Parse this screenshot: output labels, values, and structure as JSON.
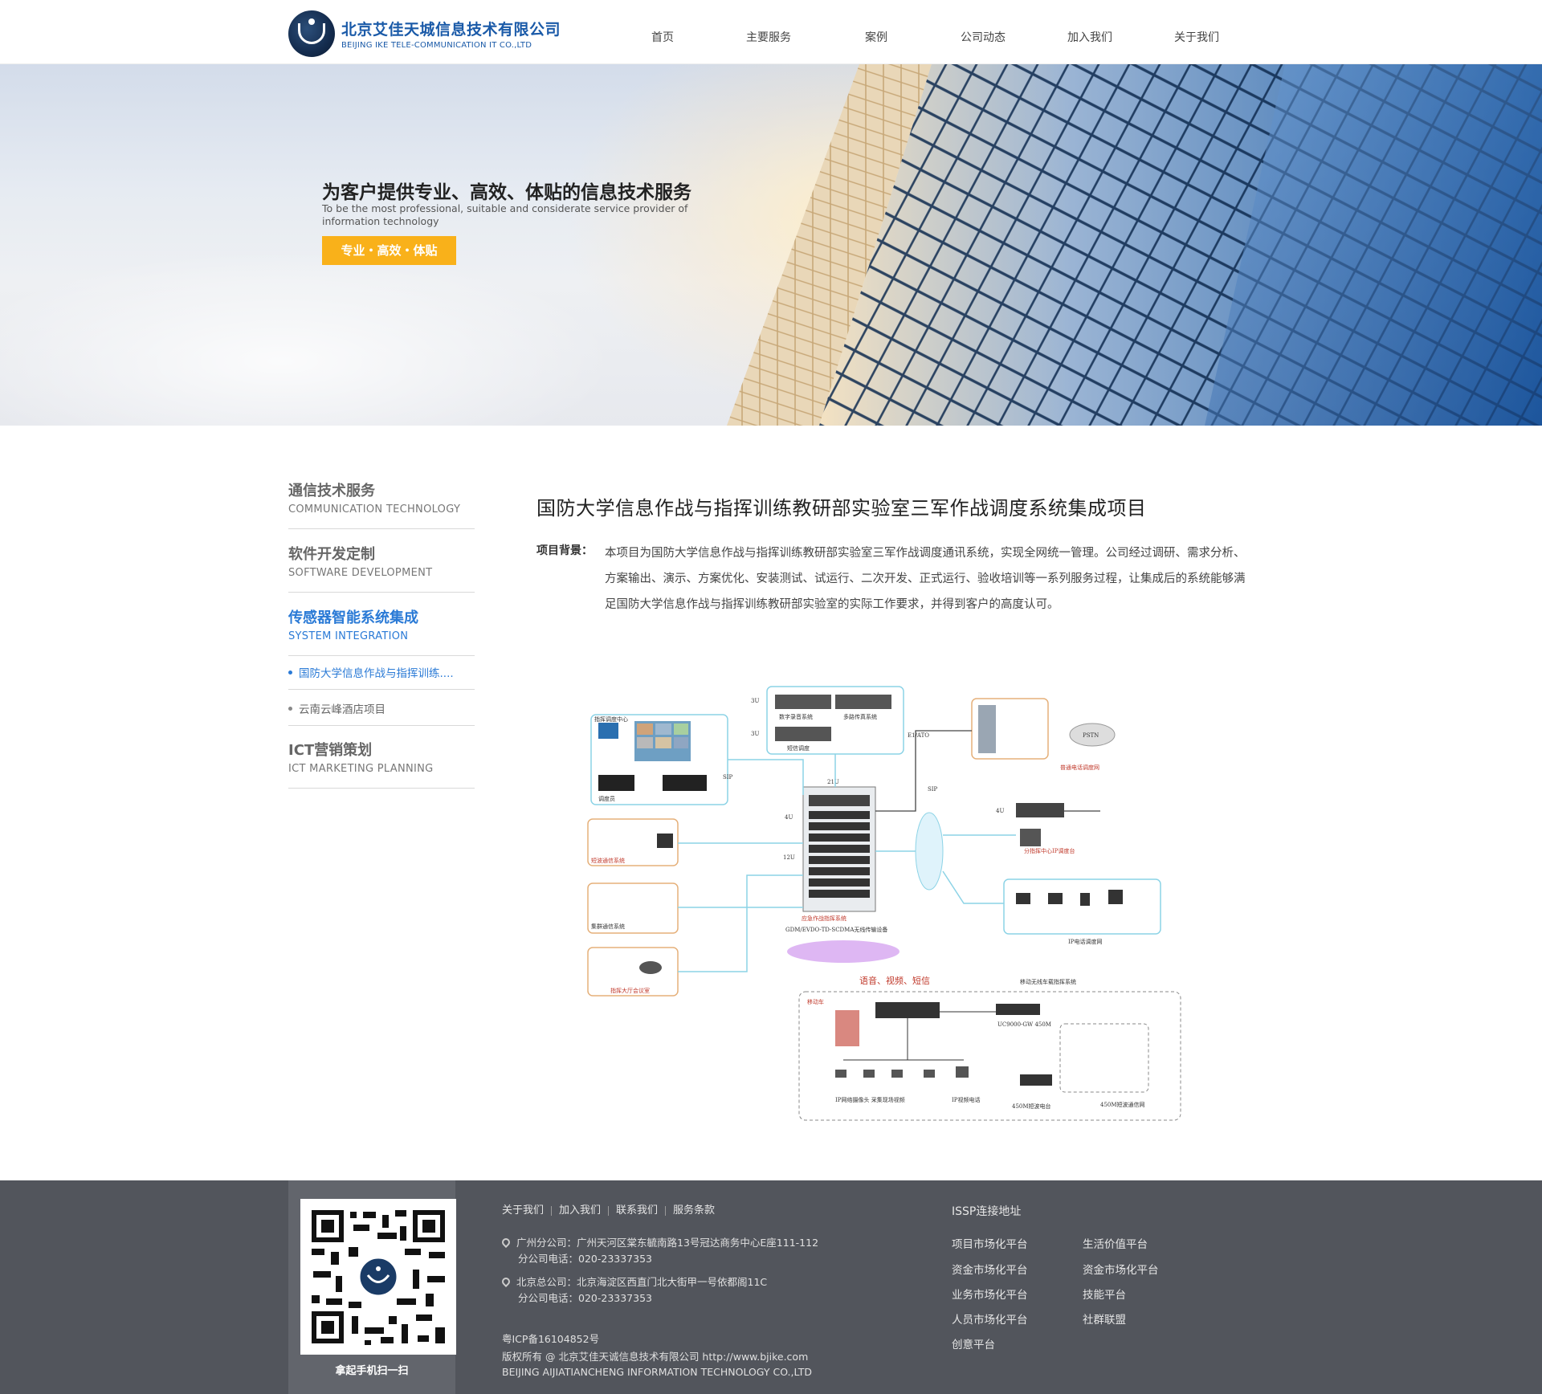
{
  "header": {
    "logo_cn": "北京艾佳天城信息技术有限公司",
    "logo_en": "BEIJING IKE TELE-COMMUNICATION IT CO.,LTD",
    "nav": [
      "首页",
      "主要服务",
      "案例",
      "公司动态",
      "加入我们",
      "关于我们"
    ]
  },
  "banner": {
    "title": "为客户提供专业、高效、体贴的信息技术服务",
    "subtitle": "To be the most professional, suitable and considerate service provider of information technology",
    "button": "专业・高效・体贴"
  },
  "sidebar": {
    "categories": [
      {
        "cn": "通信技术服务",
        "en": "COMMUNICATION TECHNOLOGY"
      },
      {
        "cn": "软件开发定制",
        "en": "SOFTWARE DEVELOPMENT"
      },
      {
        "cn": "传感器智能系统集成",
        "en": "SYSTEM INTEGRATION"
      },
      {
        "cn": "ICT营销策划",
        "en": "ICT MARKETING PLANNING"
      }
    ],
    "sub_items": [
      "国防大学信息作战与指挥训练....",
      "云南云峰酒店项目"
    ]
  },
  "main": {
    "title": "国防大学信息作战与指挥训练教研部实验室三军作战调度系统集成项目",
    "background_label": "项目背景：",
    "background_text": "本项目为国防大学信息作战与指挥训练教研部实验室三军作战调度通讯系统，实现全网统一管理。公司经过调研、需求分析、方案输出、演示、方案优化、安装测试、试运行、二次开发、正式运行、验收培训等一系列服务过程，让集成后的系统能够满足国防大学信息作战与指挥训练教研部实验室的实际工作要求，并得到客户的高度认可。"
  },
  "diagram": {
    "labels": [
      "数字录音系统",
      "多路传真系统",
      "短信调度",
      "指挥调度中心",
      "调度员",
      "SIP",
      "E1/ATO",
      "SIP",
      "短波通信系统",
      "集群通信系统",
      "指挥大厅会议室",
      "应急作战指挥系统",
      "GDM/EVDO-TD-SCDMA无线传输设备",
      "语音、视频、短信",
      "移动无线车载指挥系统",
      "IP电话调度网",
      "普通电话调度网",
      "分指挥中心IP调度台",
      "PSTN",
      "UC9000-GW 450M",
      "450M短波电台",
      "IP网络摄像头 采集现场视频",
      "IP视频电话",
      "450M短波通信网",
      "21U",
      "4U",
      "12U",
      "3U",
      "移动车"
    ]
  },
  "footer": {
    "links": [
      "关于我们",
      "加入我们",
      "联系我们",
      "服务条款"
    ],
    "guangzhou": "广州分公司：广州天河区棠东毓南路13号冠达商务中心E座111-112",
    "guangzhou_phone": "分公司电话：020-23337353",
    "beijing": "北京总公司：北京海淀区西直门北大街甲一号依都阁11C",
    "beijing_phone": "分公司电话：020-23337353",
    "icp": "粤ICP备16104852号",
    "copyright": "版权所有 @ 北京艾佳天诚信息技术有限公司 http://www.bjike.com",
    "company_en": "BEIJING AIJIATIANCHENG INFORMATION TECHNOLOGY CO.,LTD",
    "qr_caption": "拿起手机扫一扫",
    "issp_title": "ISSP连接地址",
    "issp_col1": [
      "项目市场化平台",
      "资金市场化平台",
      "业务市场化平台",
      "人员市场化平台",
      "创意平台"
    ],
    "issp_col2": [
      "生活价值平台",
      "资金市场化平台",
      "技能平台",
      "社群联盟"
    ]
  }
}
